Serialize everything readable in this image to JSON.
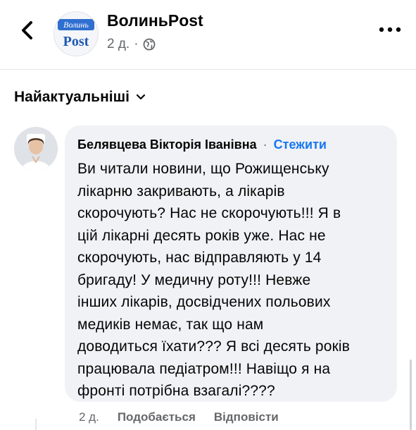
{
  "header": {
    "page_name": "ВолиньPost",
    "logo": {
      "top": "Волинь",
      "bottom": "Post"
    },
    "time": "2 д.",
    "dot": "·",
    "audience_icon": "globe-icon",
    "back_icon": "chevron-left-icon",
    "more_icon": "more-horizontal-icon"
  },
  "sort": {
    "label": "Найактуальніші",
    "icon": "chevron-down-icon"
  },
  "comment": {
    "author": "Белявцева Вікторія Іванівна",
    "separator": "·",
    "follow_label": "Стежити",
    "text": "Ви читали новини, що Рожищенську\nлікарню закривають, а лікарів\nскорочують? Нас не скорочують!!! Я в\nцій лікарні десять років уже. Нас не\nскорочують, нас відправляють у 14\nбригаду! У медичну роту!!! Невже\nінших лікарів, досвідчених польових\nмедиків немає, так що нам\nдоводиться їхати??? Я всі десять років\nпрацювала педіатром!!! Навіщо я на\nфронті потрібна взагалі????",
    "time": "2 д.",
    "like_label": "Подобається",
    "reply_label": "Відповісти"
  },
  "colors": {
    "accent": "#1877f2",
    "bubble": "#f0f2f5",
    "secondary_text": "#65676b",
    "primary_text": "#050505"
  }
}
